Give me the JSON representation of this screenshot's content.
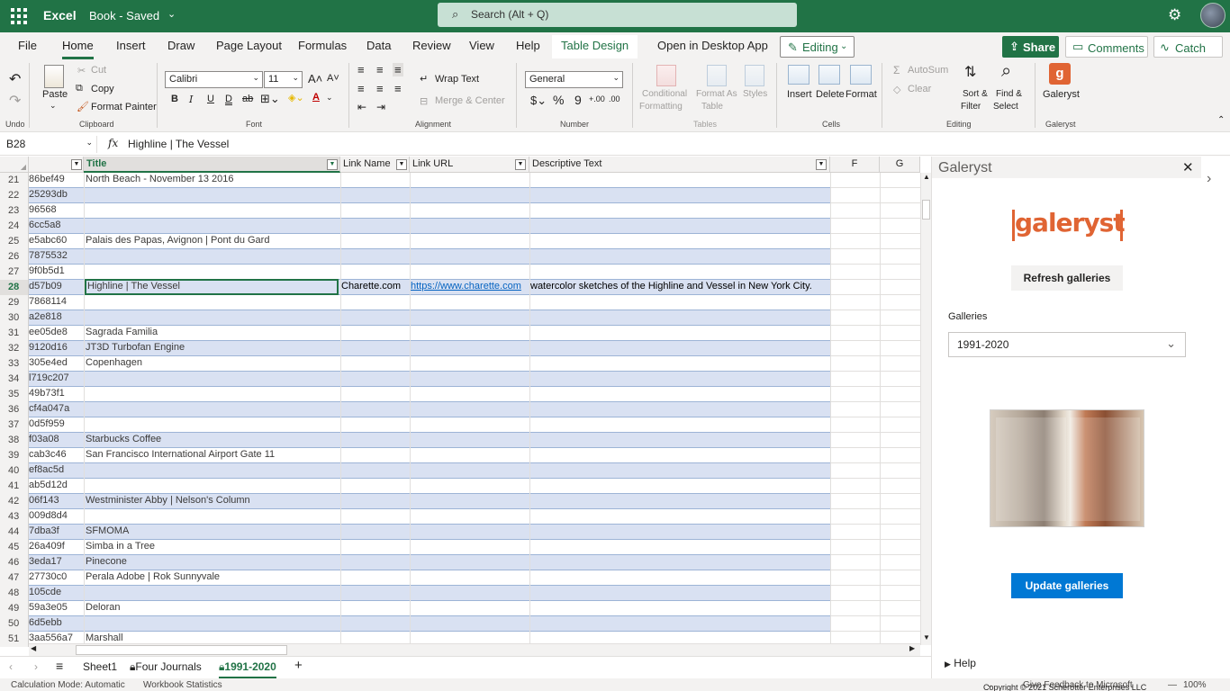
{
  "titlebar": {
    "app_name": "Excel",
    "book_name": "Book - Saved",
    "search_placeholder": "Search (Alt + Q)"
  },
  "tabs": {
    "items": [
      "File",
      "Home",
      "Insert",
      "Draw",
      "Page Layout",
      "Formulas",
      "Data",
      "Review",
      "View",
      "Help"
    ],
    "table_design": "Table Design",
    "open_desktop": "Open in Desktop App",
    "editing": "Editing",
    "share": "Share",
    "comments": "Comments",
    "catch_up": "Catch up"
  },
  "ribbon": {
    "undo_label": "Undo",
    "paste": "Paste",
    "cut": "Cut",
    "copy": "Copy",
    "format_painter": "Format Painter",
    "clipboard": "Clipboard",
    "font_name": "Calibri",
    "font_size": "11",
    "font": "Font",
    "wrap_text": "Wrap Text",
    "merge_center": "Merge & Center",
    "alignment": "Alignment",
    "number_format": "General",
    "number": "Number",
    "conditional_formatting": [
      "Conditional",
      "Formatting"
    ],
    "format_as_table": [
      "Format As",
      "Table"
    ],
    "styles": "Styles",
    "tables": "Tables",
    "insert": "Insert",
    "delete": "Delete",
    "format": "Format",
    "cells": "Cells",
    "autosum": "AutoSum",
    "clear": "Clear",
    "sort_filter": [
      "Sort &",
      "Filter"
    ],
    "find_select": [
      "Find &",
      "Select"
    ],
    "editing_group": "Editing",
    "galeryst": "Galeryst",
    "galeryst_group": "Galeryst"
  },
  "formula_bar": {
    "name_box": "B28",
    "fx": "fx",
    "content": "Highline | The Vessel"
  },
  "grid": {
    "columns": [
      "Title",
      "Link Name",
      "Link URL",
      "Descriptive Text",
      "F",
      "G"
    ],
    "rows": [
      {
        "n": "21",
        "a": "86bef49",
        "t": "North Beach - November 13 2016"
      },
      {
        "n": "22",
        "a": "25293db",
        "t": ""
      },
      {
        "n": "23",
        "a": "96568",
        "t": ""
      },
      {
        "n": "24",
        "a": "6cc5a8",
        "t": ""
      },
      {
        "n": "25",
        "a": "e5abc60",
        "t": "Palais des Papas, Avignon | Pont du Gard"
      },
      {
        "n": "26",
        "a": "7875532",
        "t": ""
      },
      {
        "n": "27",
        "a": "9f0b5d1",
        "t": ""
      },
      {
        "n": "28",
        "a": "d57b09",
        "t": "Highline | The Vessel"
      },
      {
        "n": "29",
        "a": "7868114",
        "t": ""
      },
      {
        "n": "30",
        "a": "a2e818",
        "t": ""
      },
      {
        "n": "31",
        "a": "ee05de8",
        "t": "Sagrada Familia"
      },
      {
        "n": "32",
        "a": "9120d16",
        "t": "JT3D Turbofan Engine"
      },
      {
        "n": "33",
        "a": "305e4ed",
        "t": "Copenhagen"
      },
      {
        "n": "34",
        "a": "l719c207",
        "t": ""
      },
      {
        "n": "35",
        "a": "49b73f1",
        "t": ""
      },
      {
        "n": "36",
        "a": "cf4a047a",
        "t": ""
      },
      {
        "n": "37",
        "a": "0d5f959",
        "t": ""
      },
      {
        "n": "38",
        "a": "f03a08",
        "t": "Starbucks Coffee"
      },
      {
        "n": "39",
        "a": "cab3c46",
        "t": "San Francisco International Airport Gate 11"
      },
      {
        "n": "40",
        "a": "ef8ac5d",
        "t": ""
      },
      {
        "n": "41",
        "a": "ab5d12d",
        "t": ""
      },
      {
        "n": "42",
        "a": "06f143",
        "t": "Westminister Abby | Nelson's Column"
      },
      {
        "n": "43",
        "a": "009d8d4",
        "t": ""
      },
      {
        "n": "44",
        "a": "7dba3f",
        "t": "SFMOMA"
      },
      {
        "n": "45",
        "a": "26a409f",
        "t": "Simba in a Tree"
      },
      {
        "n": "46",
        "a": "3eda17",
        "t": "Pinecone"
      },
      {
        "n": "47",
        "a": "27730c0",
        "t": "Perala Adobe | Rok Sunnyvale"
      },
      {
        "n": "48",
        "a": "105cde",
        "t": ""
      },
      {
        "n": "49",
        "a": "59a3e05",
        "t": "Deloran"
      },
      {
        "n": "50",
        "a": "6d5ebb",
        "t": ""
      },
      {
        "n": "51",
        "a": "3aa556a7",
        "t": "Marshall"
      }
    ],
    "row28": {
      "link_name": "Charette.com",
      "link_url": "https://www.charette.com",
      "descriptive": "watercolor sketches of the Highline and Vessel in New York City."
    }
  },
  "sheets": {
    "items": [
      "Sheet1",
      "Four Journals",
      "1991-2020"
    ],
    "add": "+"
  },
  "status": {
    "calc_mode": "Calculation Mode: Automatic",
    "workbook_stats": "Workbook Statistics",
    "feedback": "Give Feedback to Microsoft",
    "zoom": "100%"
  },
  "pane": {
    "title": "Galeryst",
    "logo_text": "galeryst",
    "refresh": "Refresh galleries",
    "galleries_label": "Galleries",
    "selected_gallery": "1991-2020",
    "update": "Update galleries",
    "help": "Help",
    "copyright": "Copyright © 2021 Scherotter Enterprises LLC"
  },
  "colors": {
    "excel_green": "#217346",
    "band": "#d9e1f2",
    "update_blue": "#0078d4",
    "logo_orange": "#e06433"
  }
}
